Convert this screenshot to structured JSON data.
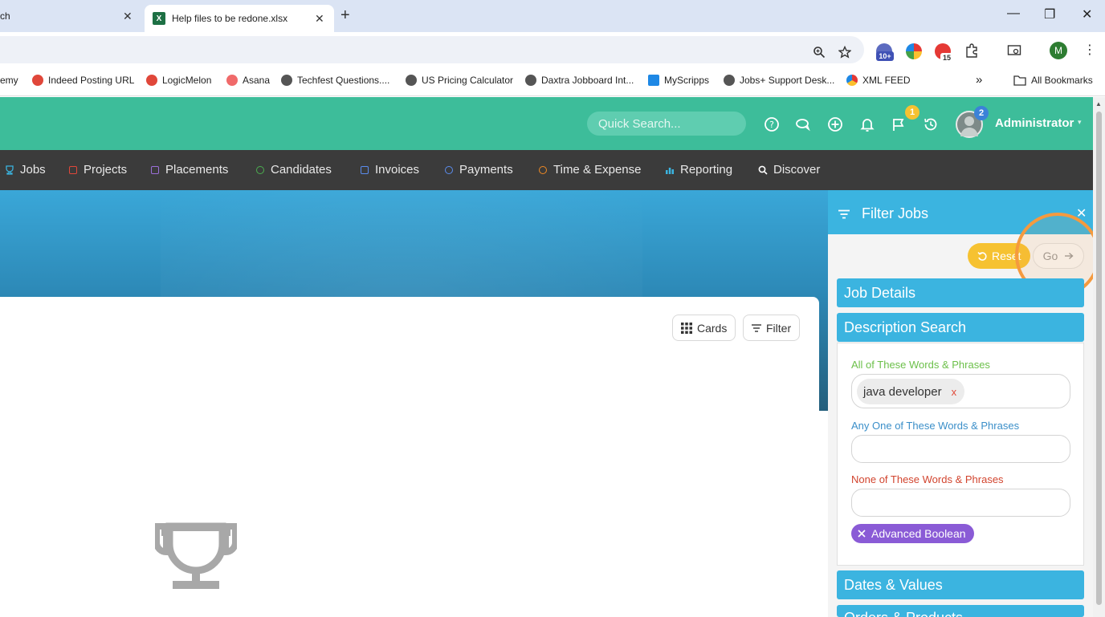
{
  "browser": {
    "tabs": [
      {
        "title": "ch",
        "close": "✕"
      },
      {
        "title": "Help files to be redone.xlsx",
        "favicon": "X",
        "close": "✕"
      }
    ],
    "new_tab": "+",
    "window_controls": {
      "minimize": "—",
      "maximize": "❐",
      "close": "✕"
    },
    "profile_initial": "M",
    "extension_badges": {
      "first": "10+",
      "second": "15"
    },
    "bookmarks": [
      "emy",
      "Indeed Posting URL",
      "LogicMelon",
      "Asana",
      "Techfest Questions....",
      "US Pricing Calculator",
      "Daxtra Jobboard Int...",
      "MyScripps",
      "Jobs+ Support Desk...",
      "XML FEED"
    ],
    "bookmarks_more": "»",
    "all_bookmarks": "All Bookmarks"
  },
  "header": {
    "search_placeholder": "Quick Search...",
    "flag_badge": "1",
    "avatar_badge": "2",
    "user_name": "Administrator",
    "caret": "▾"
  },
  "nav": {
    "items": [
      {
        "label": "Jobs",
        "color": "#3bb4e0"
      },
      {
        "label": "Projects",
        "color": "#e0473a"
      },
      {
        "label": "Placements",
        "color": "#9b6fd9"
      },
      {
        "label": "Candidates",
        "color": "#4caf50"
      },
      {
        "label": "Invoices",
        "color": "#5b8def"
      },
      {
        "label": "Payments",
        "color": "#5b8def"
      },
      {
        "label": "Time & Expense",
        "color": "#f08a24"
      },
      {
        "label": "Reporting",
        "color": "#3bb4e0"
      },
      {
        "label": "Discover",
        "color": "#ffffff"
      }
    ]
  },
  "content": {
    "cards_label": "Cards",
    "filter_label": "Filter"
  },
  "filter_panel": {
    "title": "Filter Jobs",
    "close": "✕",
    "reset_label": "Reset",
    "go_label": "Go",
    "sections": {
      "job_details": "Job Details",
      "description_search": "Description Search",
      "dates_values": "Dates & Values",
      "orders_products": "Orders & Products"
    },
    "all_words_label": "All of These Words & Phrases",
    "all_words_chip": "java developer",
    "chip_remove": "x",
    "any_words_label": "Any One of These Words & Phrases",
    "none_words_label": "None of These Words & Phrases",
    "advanced_boolean": "Advanced Boolean"
  }
}
